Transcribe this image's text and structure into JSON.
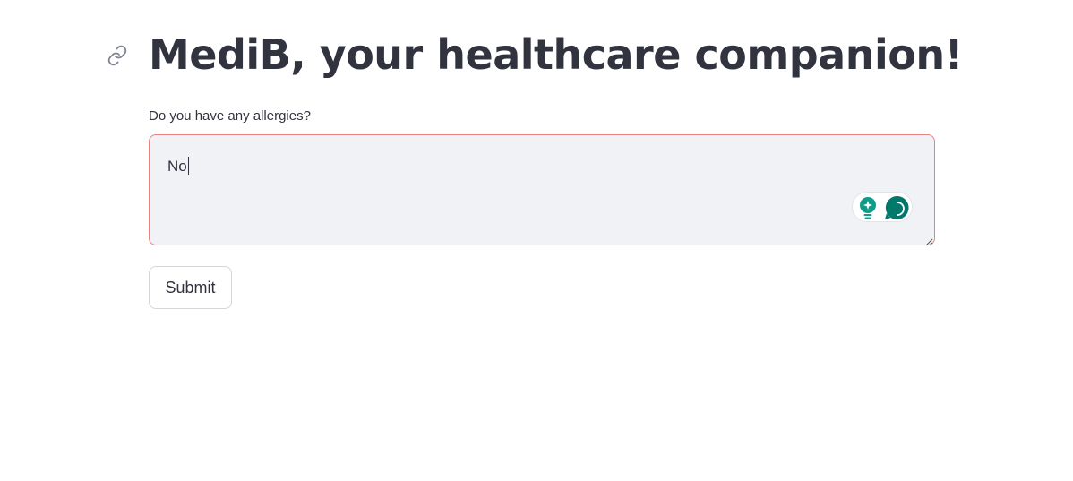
{
  "header": {
    "title": "MediB, your healthcare companion!",
    "anchor_icon": "link-icon"
  },
  "form": {
    "question_label": "Do you have any allergies?",
    "answer_value": "No",
    "submit_label": "Submit"
  },
  "assistant": {
    "icons": [
      "lightbulb-icon",
      "chat-bubble-icon"
    ]
  },
  "colors": {
    "text": "#31333f",
    "input_background": "#f0f2f6",
    "input_focus_border": "#e8827f",
    "assistant_accent": "#0f9d8a",
    "assistant_dark": "#00796b"
  }
}
